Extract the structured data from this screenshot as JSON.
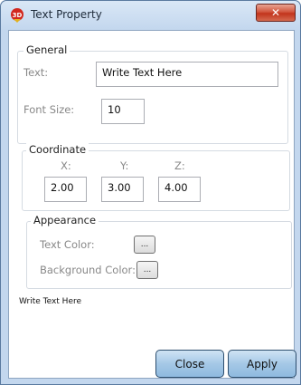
{
  "window": {
    "title": "Text Property",
    "icon": "3d-logo-icon",
    "close_glyph": "✕"
  },
  "general": {
    "legend": "General",
    "text_label": "Text:",
    "text_value": "Write Text Here",
    "font_size_label": "Font Size:",
    "font_size_value": "10"
  },
  "coordinate": {
    "legend": "Coordinate",
    "x_label": "X:",
    "y_label": "Y:",
    "z_label": "Z:",
    "x_value": "2.00",
    "y_value": "3.00",
    "z_value": "4.00"
  },
  "appearance": {
    "legend": "Appearance",
    "text_color_label": "Text Color:",
    "background_color_label": "Background Color:",
    "picker_label": "..."
  },
  "preview": {
    "text": "Write Text Here"
  },
  "buttons": {
    "close": "Close",
    "apply": "Apply"
  },
  "colors": {
    "frame": "#c3d7ee",
    "close_button": "#c2341c",
    "action_button": "#a5c8e6"
  }
}
